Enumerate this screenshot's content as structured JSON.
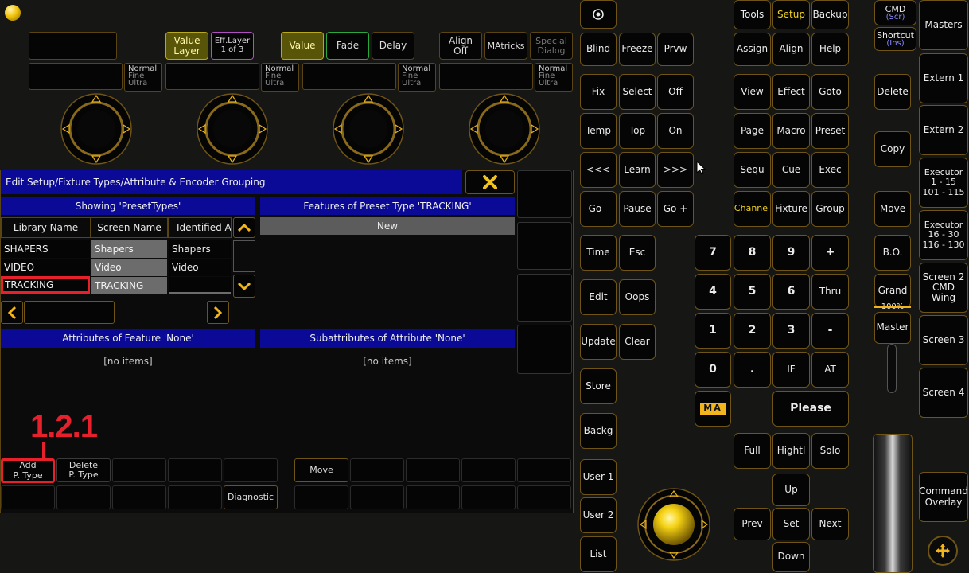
{
  "header": {
    "value_layer": "Value\nLayer",
    "eff_layer": "Eff.Layer\n1 of 3",
    "value": "Value",
    "fade": "Fade",
    "delay": "Delay",
    "align_off": "Align\nOff",
    "matricks": "MAtricks",
    "special_dialog": "Special\nDialog",
    "resolution": [
      "Normal",
      "Fine",
      "Ultra"
    ]
  },
  "dialog": {
    "title": "Edit Setup/Fixture Types/Attribute & Encoder Grouping",
    "left_title": "Showing 'PresetTypes'",
    "right_title": "Features of Preset Type 'TRACKING'",
    "new_label": "New",
    "columns": [
      "Library Name",
      "Screen Name",
      "Identified A"
    ],
    "rows": [
      [
        "SHAPERS",
        "Shapers",
        "Shapers"
      ],
      [
        "VIDEO",
        "Video",
        "Video"
      ],
      [
        "TRACKING",
        "TRACKING",
        ""
      ]
    ],
    "attributes_title": "Attributes of Feature 'None'",
    "subattributes_title": "Subattributes of Attribute 'None'",
    "no_items": "[no items]",
    "annotation": "1.2.1",
    "bottom_buttons": {
      "add": "Add\nP. Type",
      "delete": "Delete\nP. Type",
      "move": "Move",
      "diagnostic": "Diagnostic"
    }
  },
  "console": {
    "col1": [
      "Blind",
      "Fix",
      "Temp",
      "<<<",
      "Go -",
      "Time",
      "Edit",
      "Update",
      "Store",
      "Backg",
      "User 1",
      "User 2",
      "List"
    ],
    "col2": [
      "Freeze",
      "Select",
      "Top",
      "Learn",
      "Pause",
      "Esc",
      "Oops",
      "Clear"
    ],
    "col3": [
      "Prvw",
      "Off",
      "On",
      ">>>",
      "Go +"
    ],
    "top_grid": [
      [
        "Tools",
        "Setup",
        "Backup"
      ],
      [
        "Assign",
        "Align",
        "Help"
      ],
      [
        "View",
        "Effect",
        "Goto"
      ],
      [
        "Page",
        "Macro",
        "Preset"
      ],
      [
        "Sequ",
        "Cue",
        "Exec"
      ],
      [
        "Channel",
        "Fixture",
        "Group"
      ]
    ],
    "keypad": [
      [
        "7",
        "8",
        "9",
        "+"
      ],
      [
        "4",
        "5",
        "6",
        "Thru"
      ],
      [
        "1",
        "2",
        "3",
        "-"
      ],
      [
        "0",
        ".",
        "IF",
        "AT"
      ]
    ],
    "please": "Please",
    "logo": "MA",
    "view_buttons": [
      "Full",
      "Hightl",
      "Solo"
    ],
    "nav": {
      "up": "Up",
      "prev": "Prev",
      "set": "Set",
      "next": "Next",
      "down": "Down"
    },
    "right_col": [
      "Delete",
      "Copy",
      "Move",
      "B.O."
    ],
    "cmd": {
      "label": "CMD",
      "sub": "(Scr)"
    },
    "shortcut": {
      "label": "Shortcut",
      "sub": "(Ins)"
    },
    "grand": {
      "label": "Grand",
      "level": "100%",
      "master": "Master"
    },
    "screens": [
      "Masters",
      "Extern 1",
      "Extern 2",
      "Executor\n1 - 15\n101 - 115",
      "Executor\n16 - 30\n116 - 130",
      "Screen 2\nCMD Wing",
      "Screen 3",
      "Screen 4",
      "Command\nOverlay"
    ]
  },
  "colors": {
    "accent": "#f2d21c",
    "title_bar": "#0a0a96",
    "border": "#6e5416",
    "highlight_red": "#e8202c"
  }
}
